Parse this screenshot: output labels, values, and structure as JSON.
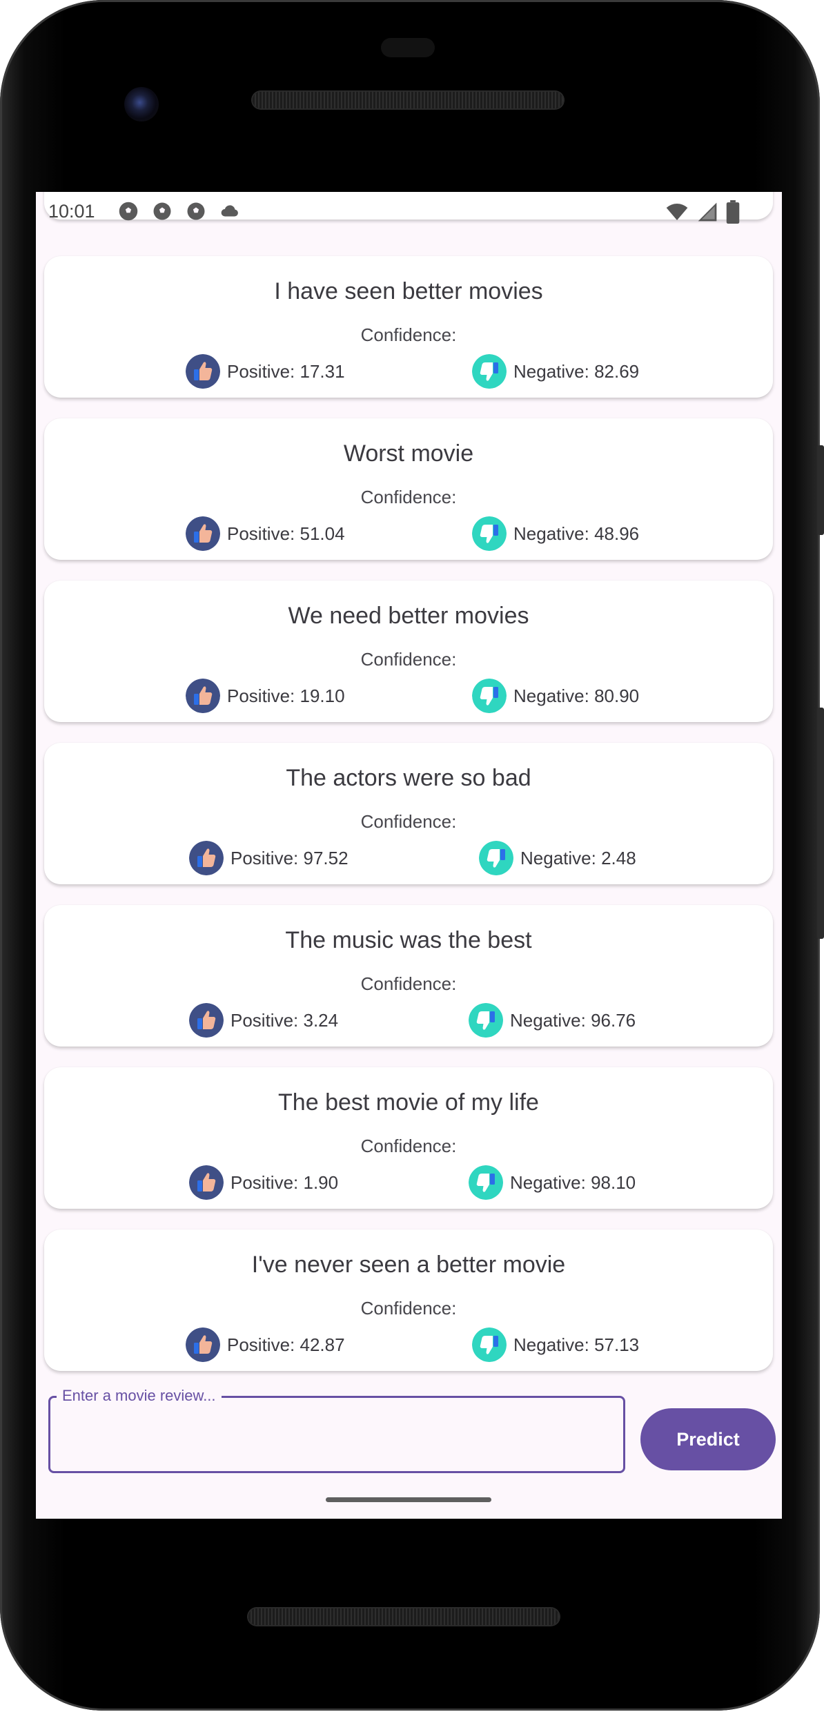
{
  "status_bar": {
    "time": "10:01",
    "left_icons": [
      "soccer-ball-icon",
      "soccer-ball-icon",
      "soccer-ball-icon",
      "cloud-icon"
    ],
    "right_icons": [
      "wifi-icon",
      "cell-signal-icon",
      "battery-icon"
    ]
  },
  "reviews": [
    {
      "title": "I have seen better movies",
      "confidence_label": "Confidence:",
      "positive": "Positive: 17.31",
      "negative": "Negative: 82.69"
    },
    {
      "title": "Worst movie",
      "confidence_label": "Confidence:",
      "positive": "Positive: 51.04",
      "negative": "Negative: 48.96"
    },
    {
      "title": "We need better movies",
      "confidence_label": "Confidence:",
      "positive": "Positive: 19.10",
      "negative": "Negative: 80.90"
    },
    {
      "title": "The actors were so bad",
      "confidence_label": "Confidence:",
      "positive": "Positive: 97.52",
      "negative": "Negative: 2.48"
    },
    {
      "title": "The music was the best",
      "confidence_label": "Confidence:",
      "positive": "Positive: 3.24",
      "negative": "Negative: 96.76"
    },
    {
      "title": "The best movie of my life",
      "confidence_label": "Confidence:",
      "positive": "Positive: 1.90",
      "negative": "Negative: 98.10"
    },
    {
      "title": "I've never seen a better movie",
      "confidence_label": "Confidence:",
      "positive": "Positive: 42.87",
      "negative": "Negative: 57.13"
    }
  ],
  "input": {
    "label": "Enter a movie review...",
    "value": ""
  },
  "predict_button": {
    "label": "Predict"
  },
  "colors": {
    "accent": "#6750a4",
    "positive_icon_bg": "#3f4f86",
    "negative_icon_bg": "#2fd6c0",
    "screen_bg": "#fdf7fc"
  }
}
